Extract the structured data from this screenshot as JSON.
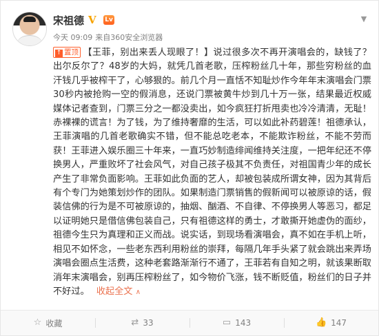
{
  "post": {
    "author_name": "宋祖德",
    "vip_badge": "V",
    "level_badge": "Lv",
    "time": "今天 09:09",
    "source": "来自360安全浏览器",
    "top_tag": "置顶",
    "content": "【王菲，别出来丢人现眼了！】说过很多次不再开演唱会的，缺钱了？出尔反尔了？48岁的大妈，就凭几首老歌，压榨粉丝几十年，那些穷粉丝的血汗钱几乎被榨干了，心够狠的。前几个月一直恬不知耻炒作今年年末演唱会门票30秒内被抢购一空的假消息，还说门票被黄牛炒到几十万一张，结果最近权威媒体记者查到，门票三分之一都没卖出，如今疯狂打折甩卖也冷冷清清，无耻！赤裸裸的谎言！为了钱，为了维持奢靡的生活，可以如此补药碧莲！祖德承认，王菲演唱的几首老歌确实不错，但不能总吃老本，不能欺诈粉丝，不能不劳而获！王菲进入娱乐圈三十年来，一直巧妙制造绯闻维持关注度，一把年纪还不停换男人，严重败坏了社会风气，对自己孩子极其不负责任，对祖国青少年的成长产生了非常负面影响。王菲如此负面的艺人，却被包装成所谓女神，因为其背后有个专门为她策划炒作的团队。如果制造门票销售的假新闻可以被原谅的话，假装信佛的行为是不可被原谅的，抽烟、酗酒、不自律、不停换男人等恶习，都足以证明她只是借信佛包装自己，只有祖德这样的勇士，才敢撕开她虚伪的面纱，祖德今生只为真理和正义而战。说实话，到现场看演唱会，真不如在手机上听，相见不如怀念，一些老东西利用粉丝的崇拜，每隔几年手头紧了就会跳出来弄场演唱会圈点生活费，这种老套路渐渐行不通了，王菲若有自知之明，就该果断取消年末演唱会，别再压榨粉丝了，如今物价飞涨，钱不断贬值，粉丝们的日子并不好过。",
    "expand_label": "收起全文",
    "expand_arrow": "∧"
  },
  "actions": {
    "favorite_label": "收藏",
    "repost_count": "33",
    "comment_count": "143",
    "like_count": "147"
  },
  "icons": {
    "favorite": "star-icon",
    "repost": "repost-icon",
    "comment": "comment-icon",
    "like": "thumbs-up-icon",
    "dropdown": "chevron-down-icon"
  },
  "colors": {
    "accent": "#eb7350",
    "top_tag": "#ff5e2b",
    "vip": "#f7a300",
    "meta_text": "#808080"
  }
}
